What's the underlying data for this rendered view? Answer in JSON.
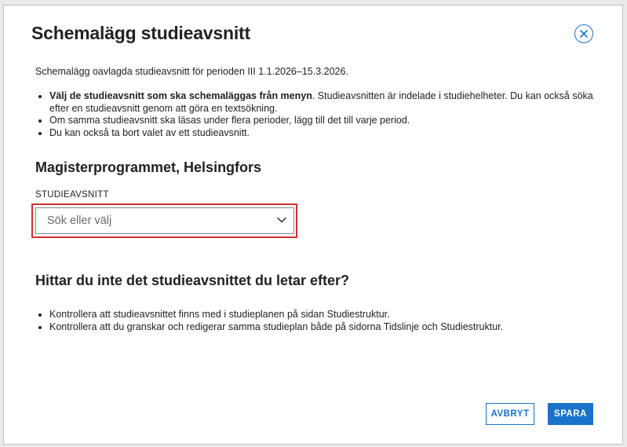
{
  "dialog": {
    "title": "Schemalägg studieavsnitt",
    "close_icon": "close-circle-icon",
    "intro_prefix": "Schemalägg oavlagda studieavsnitt för perioden",
    "intro_period": "III 1.1.2026–15.3.2026.",
    "instructions": [
      {
        "bold": "Välj de studieavsnitt som ska schemaläggas från menyn",
        "text": ". Studieavsnitten är indelade i studiehelheter. Du kan också söka efter en studieavsnitt genom att göra en textsökning."
      },
      {
        "bold": "",
        "text": "Om samma studieavsnitt ska läsas under flera perioder, lägg till det till varje period."
      },
      {
        "bold": "",
        "text": "Du kan också ta bort valet av ett studieavsnitt."
      }
    ],
    "programme_heading": "Magisterprogrammet, Helsingfors",
    "field_label": "STUDIEAVSNITT",
    "select_placeholder": "Sök eller välj",
    "select_icon": "chevron-down-icon",
    "help_heading": "Hittar du inte det studieavsnittet du letar efter?",
    "help_items": [
      "Kontrollera att studieavsnittet finns med i studieplanen på sidan Studiestruktur.",
      "Kontrollera att du granskar och redigerar samma studieplan både på sidorna Tidslinje och Studiestruktur."
    ],
    "cancel_label": "AVBRYT",
    "save_label": "SPARA"
  },
  "colors": {
    "accent": "#1a73c8",
    "highlight": "#d32f2f",
    "text": "#222222"
  }
}
